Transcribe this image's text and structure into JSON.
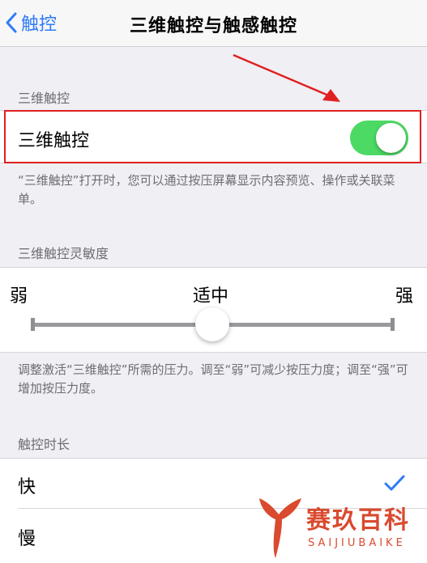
{
  "nav": {
    "back_label": "触控",
    "title": "三维触控与触感触控"
  },
  "three_d_section": {
    "header": "三维触控",
    "toggle_label": "三维触控",
    "toggle_on": true,
    "footer": "“三维触控”打开时，您可以通过按压屏幕显示内容预览、操作或关联菜单。"
  },
  "sensitivity_section": {
    "header": "三维触控灵敏度",
    "min_label": "弱",
    "mid_label": "适中",
    "max_label": "强",
    "slider_value": 0.5,
    "footer": "调整激活“三维触控”所需的压力。调至“弱”可减少按压力度；调至“强”可增加按压力度。"
  },
  "duration_section": {
    "header": "触控时长",
    "options": [
      {
        "label": "快",
        "selected": true
      },
      {
        "label": "慢",
        "selected": false
      }
    ]
  },
  "watermark": {
    "text": "赛玖百科",
    "subtext": "SAIJIUBAIKE"
  },
  "colors": {
    "accent": "#2f7bf6",
    "toggle_on": "#4cd964",
    "highlight": "#e02020",
    "watermark": "#d94a2e"
  }
}
